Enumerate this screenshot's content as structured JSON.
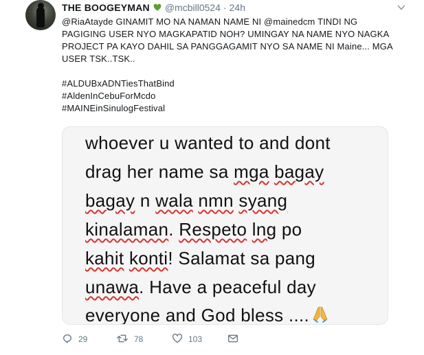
{
  "tweet": {
    "display_name": "THE BOOGEYMAN",
    "name_emoji": "green-heart-icon",
    "handle": "@mcbill0524",
    "separator": "·",
    "time": "24h",
    "text_lines": [
      "@RiaAtayde GINAMIT MO NA NAMAN NAME NI @mainedcm TINDI NG",
      "PAGIGING USER NYO MAGKAPATID NOH? UMINGAY NA NAME NYO NAGKA",
      "PROJECT PA KAYO DAHIL SA PANGGAGAMIT NYO SA NAME NI Maine... MGA",
      "USER TSK..TSK.."
    ],
    "hashtags": [
      "#ALDUBxADNTiesThatBind",
      "#AldenInCebuForMcdo",
      "#MAINEinSinulogFestival"
    ]
  },
  "media": {
    "lines": [
      [
        {
          "t": "whoever u wanted to and dont",
          "s": false
        }
      ],
      [
        {
          "t": "drag her name sa ",
          "s": false
        },
        {
          "t": "mga",
          "s": true
        },
        {
          "t": " ",
          "s": false
        },
        {
          "t": "bagay",
          "s": true
        }
      ],
      [
        {
          "t": "bagay",
          "s": true
        },
        {
          "t": " n ",
          "s": false
        },
        {
          "t": "wala",
          "s": true
        },
        {
          "t": " ",
          "s": false
        },
        {
          "t": "nmn",
          "s": true
        },
        {
          "t": " ",
          "s": false
        },
        {
          "t": "syang",
          "s": true
        }
      ],
      [
        {
          "t": "kinalaman",
          "s": true
        },
        {
          "t": ".  ",
          "s": false
        },
        {
          "t": "Respeto",
          "s": true
        },
        {
          "t": " ",
          "s": false
        },
        {
          "t": "lng",
          "s": true
        },
        {
          "t": " po",
          "s": false
        }
      ],
      [
        {
          "t": "kahit",
          "s": true
        },
        {
          "t": " ",
          "s": false
        },
        {
          "t": "konti",
          "s": true
        },
        {
          "t": "! Salamat sa pang",
          "s": false
        }
      ],
      [
        {
          "t": "unawa",
          "s": true
        },
        {
          "t": ". Have a peaceful day",
          "s": false
        }
      ],
      [
        {
          "t": "everyone and God bless ....",
          "s": false
        }
      ]
    ],
    "trailing_emoji": "praying-hands-icon"
  },
  "actions": {
    "reply_count": "29",
    "retweet_count": "78",
    "like_count": "103"
  },
  "colors": {
    "text": "#14171a",
    "muted": "#657786",
    "spellcheck": "#d9322e",
    "media_bg": "#f5f5f5"
  }
}
